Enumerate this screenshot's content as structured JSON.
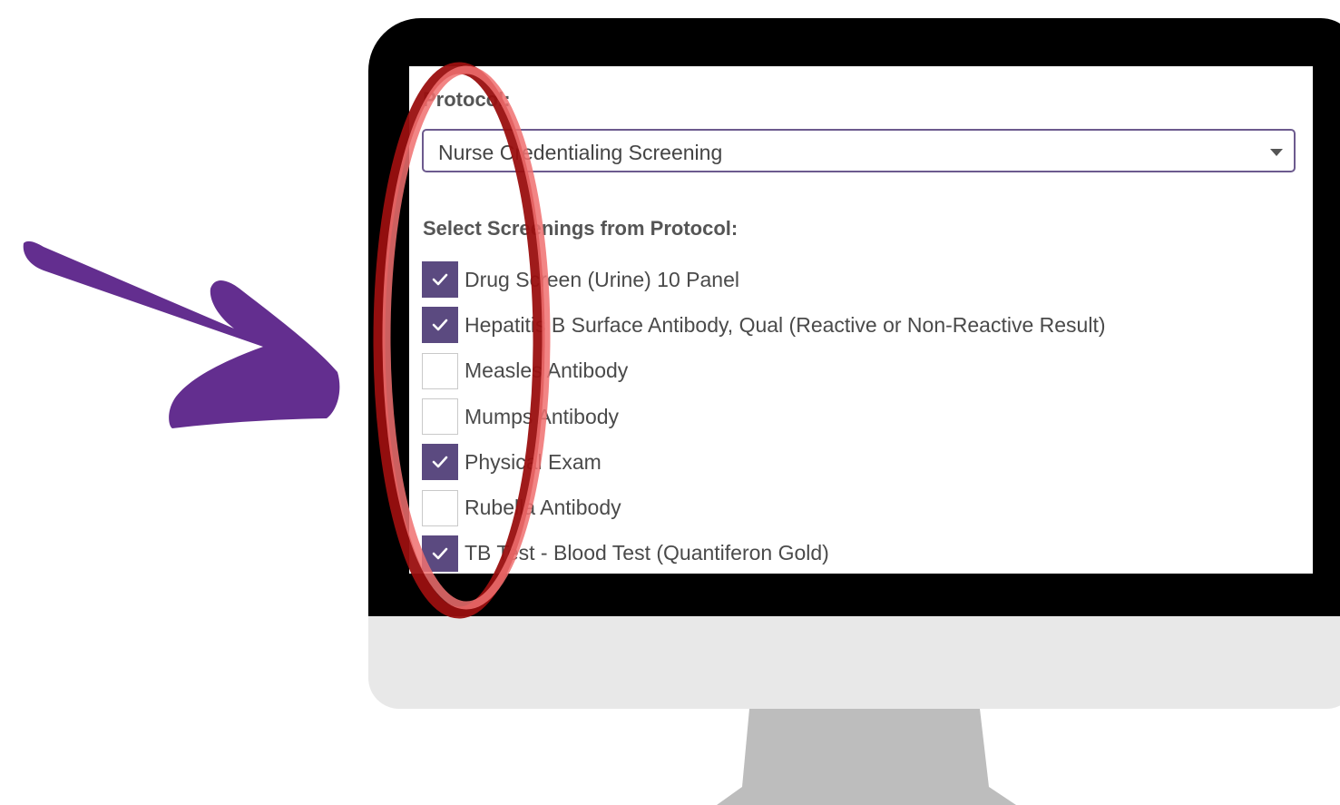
{
  "form": {
    "protocol_label": "Protocol:",
    "protocol_value": "Nurse Credentialing Screening",
    "screenings_heading": "Select Screenings from Protocol:",
    "screenings": [
      {
        "label": "Drug Screen (Urine) 10 Panel",
        "checked": true
      },
      {
        "label": "Hepatitis B Surface Antibody, Qual (Reactive or Non-Reactive Result)",
        "checked": true
      },
      {
        "label": "Measles Antibody",
        "checked": false
      },
      {
        "label": "Mumps Antibody",
        "checked": false
      },
      {
        "label": "Physical Exam",
        "checked": true
      },
      {
        "label": "Rubella Antibody",
        "checked": false
      },
      {
        "label": "TB Test - Blood Test (Quantiferon Gold)",
        "checked": true
      }
    ]
  },
  "colors": {
    "accent_purple": "#5b4a80",
    "arrow_purple": "#632e8f",
    "highlight_red": "#e8392e"
  },
  "icons": [
    "checkmark-icon",
    "chevron-down-icon",
    "arrow-annotation",
    "ellipse-highlight"
  ]
}
